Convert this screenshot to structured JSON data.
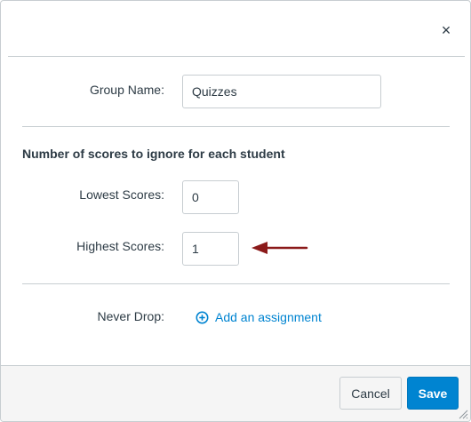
{
  "dialog": {
    "close_label": "×",
    "group_name_label": "Group Name:",
    "group_name_value": "Quizzes",
    "section_title": "Number of scores to ignore for each student",
    "lowest_label": "Lowest Scores:",
    "lowest_value": "0",
    "highest_label": "Highest Scores:",
    "highest_value": "1",
    "never_drop_label": "Never Drop:",
    "add_assignment_label": "Add an assignment",
    "add_icon": "plus-circle-icon",
    "annotation_arrow_color": "#8b1a1a"
  },
  "footer": {
    "cancel_label": "Cancel",
    "save_label": "Save"
  },
  "colors": {
    "accent": "#0084d1",
    "border": "#c7cdd1",
    "text": "#2d3b45",
    "footer_bg": "#f5f5f5"
  }
}
